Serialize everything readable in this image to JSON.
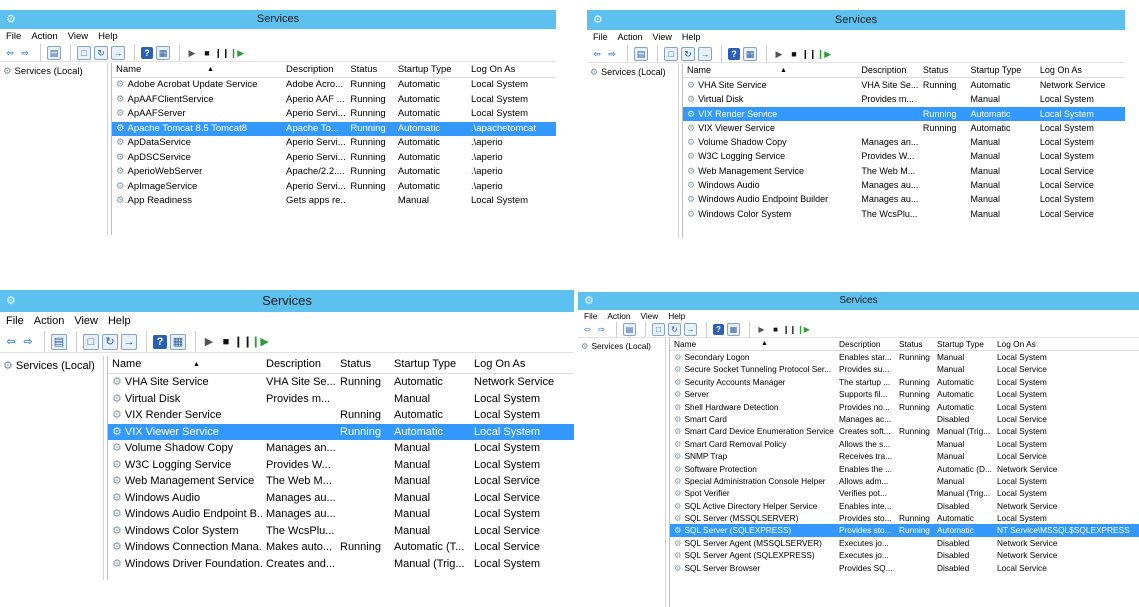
{
  "common": {
    "title": "Services",
    "menu": [
      "File",
      "Action",
      "View",
      "Help"
    ],
    "tree_label": "Services (Local)",
    "columns": [
      "Name",
      "Description",
      "Status",
      "Startup Type",
      "Log On As"
    ]
  },
  "windows": [
    {
      "id": "w1",
      "rows": [
        [
          "Adobe Acrobat Update Service",
          "Adobe Acro...",
          "Running",
          "Automatic",
          "Local System"
        ],
        [
          "ApAAFClientService",
          "Aperio AAF ...",
          "Running",
          "Automatic",
          "Local System"
        ],
        [
          "ApAAFServer",
          "Aperio Servi...",
          "Running",
          "Automatic",
          "Local System"
        ],
        [
          "Apache Tomcat 8.5 Tomcat8",
          "Apache To...",
          "Running",
          "Automatic",
          ".\\apachetomcat"
        ],
        [
          "ApDataService",
          "Aperio Servi...",
          "Running",
          "Automatic",
          ".\\aperio"
        ],
        [
          "ApDSCService",
          "Aperio Servi...",
          "Running",
          "Automatic",
          ".\\aperio"
        ],
        [
          "AperioWebServer",
          "Apache/2.2....",
          "Running",
          "Automatic",
          ".\\aperio"
        ],
        [
          "ApImageService",
          "Aperio Servi...",
          "Running",
          "Automatic",
          ".\\aperio"
        ],
        [
          "App Readiness",
          "Gets apps re...",
          "",
          "Manual",
          "Local System"
        ]
      ],
      "selected": 3
    },
    {
      "id": "w2",
      "rows": [
        [
          "VHA Site Service",
          "VHA Site Se...",
          "Running",
          "Automatic",
          "Network Service"
        ],
        [
          "Virtual Disk",
          "Provides m...",
          "",
          "Manual",
          "Local System"
        ],
        [
          "VIX Render Service",
          "",
          "Running",
          "Automatic",
          "Local System"
        ],
        [
          "VIX Viewer Service",
          "",
          "Running",
          "Automatic",
          "Local System"
        ],
        [
          "Volume Shadow Copy",
          "Manages an...",
          "",
          "Manual",
          "Local System"
        ],
        [
          "W3C Logging Service",
          "Provides W...",
          "",
          "Manual",
          "Local System"
        ],
        [
          "Web Management Service",
          "The Web M...",
          "",
          "Manual",
          "Local Service"
        ],
        [
          "Windows Audio",
          "Manages au...",
          "",
          "Manual",
          "Local Service"
        ],
        [
          "Windows Audio Endpoint Builder",
          "Manages au...",
          "",
          "Manual",
          "Local System"
        ],
        [
          "Windows Color System",
          "The WcsPlu...",
          "",
          "Manual",
          "Local Service"
        ]
      ],
      "selected": 2
    },
    {
      "id": "w3",
      "rows": [
        [
          "VHA Site Service",
          "VHA Site Se...",
          "Running",
          "Automatic",
          "Network Service"
        ],
        [
          "Virtual Disk",
          "Provides m...",
          "",
          "Manual",
          "Local System"
        ],
        [
          "VIX Render Service",
          "",
          "Running",
          "Automatic",
          "Local System"
        ],
        [
          "VIX Viewer Service",
          "",
          "Running",
          "Automatic",
          "Local System"
        ],
        [
          "Volume Shadow Copy",
          "Manages an...",
          "",
          "Manual",
          "Local System"
        ],
        [
          "W3C Logging Service",
          "Provides W...",
          "",
          "Manual",
          "Local System"
        ],
        [
          "Web Management Service",
          "The Web M...",
          "",
          "Manual",
          "Local Service"
        ],
        [
          "Windows Audio",
          "Manages au...",
          "",
          "Manual",
          "Local Service"
        ],
        [
          "Windows Audio Endpoint B...",
          "Manages au...",
          "",
          "Manual",
          "Local System"
        ],
        [
          "Windows Color System",
          "The WcsPlu...",
          "",
          "Manual",
          "Local Service"
        ],
        [
          "Windows Connection Mana...",
          "Makes auto...",
          "Running",
          "Automatic (T...",
          "Local Service"
        ],
        [
          "Windows Driver Foundation...",
          "Creates and...",
          "",
          "Manual (Trig...",
          "Local System"
        ]
      ],
      "selected": 3
    },
    {
      "id": "w4",
      "rows": [
        [
          "Secondary Logon",
          "Enables star...",
          "Running",
          "Manual",
          "Local System"
        ],
        [
          "Secure Socket Tunneling Protocol Ser...",
          "Provides su...",
          "",
          "Manual",
          "Local Service"
        ],
        [
          "Security Accounts Manager",
          "The startup ...",
          "Running",
          "Automatic",
          "Local System"
        ],
        [
          "Server",
          "Supports fil...",
          "Running",
          "Automatic",
          "Local System"
        ],
        [
          "Shell Hardware Detection",
          "Provides no...",
          "Running",
          "Automatic",
          "Local System"
        ],
        [
          "Smart Card",
          "Manages ac...",
          "",
          "Disabled",
          "Local Service"
        ],
        [
          "Smart Card Device Enumeration Service",
          "Creates soft...",
          "Running",
          "Manual (Trig...",
          "Local System"
        ],
        [
          "Smart Card Removal Policy",
          "Allows the s...",
          "",
          "Manual",
          "Local System"
        ],
        [
          "SNMP Trap",
          "Receives tra...",
          "",
          "Manual",
          "Local Service"
        ],
        [
          "Software Protection",
          "Enables the ...",
          "",
          "Automatic (D...",
          "Network Service"
        ],
        [
          "Special Administration Console Helper",
          "Allows adm...",
          "",
          "Manual",
          "Local System"
        ],
        [
          "Spot Verifier",
          "Verifies pot...",
          "",
          "Manual (Trig...",
          "Local System"
        ],
        [
          "SQL Active Directory Helper Service",
          "Enables inte...",
          "",
          "Disabled",
          "Network Service"
        ],
        [
          "SQL Server (MSSQLSERVER)",
          "Provides sto...",
          "Running",
          "Automatic",
          "Local System"
        ],
        [
          "SQL Server (SQLEXPRESS)",
          "Provides sto...",
          "Running",
          "Automatic",
          "NT Service\\MSSQL$SQLEXPRESS"
        ],
        [
          "SQL Server Agent (MSSQLSERVER)",
          "Executes jo...",
          "",
          "Disabled",
          "Network Service"
        ],
        [
          "SQL Server Agent (SQLEXPRESS)",
          "Executes jo...",
          "",
          "Disabled",
          "Network Service"
        ],
        [
          "SQL Server Browser",
          "Provides SQ...",
          "",
          "Disabled",
          "Local Service"
        ]
      ],
      "selected": 14
    }
  ]
}
